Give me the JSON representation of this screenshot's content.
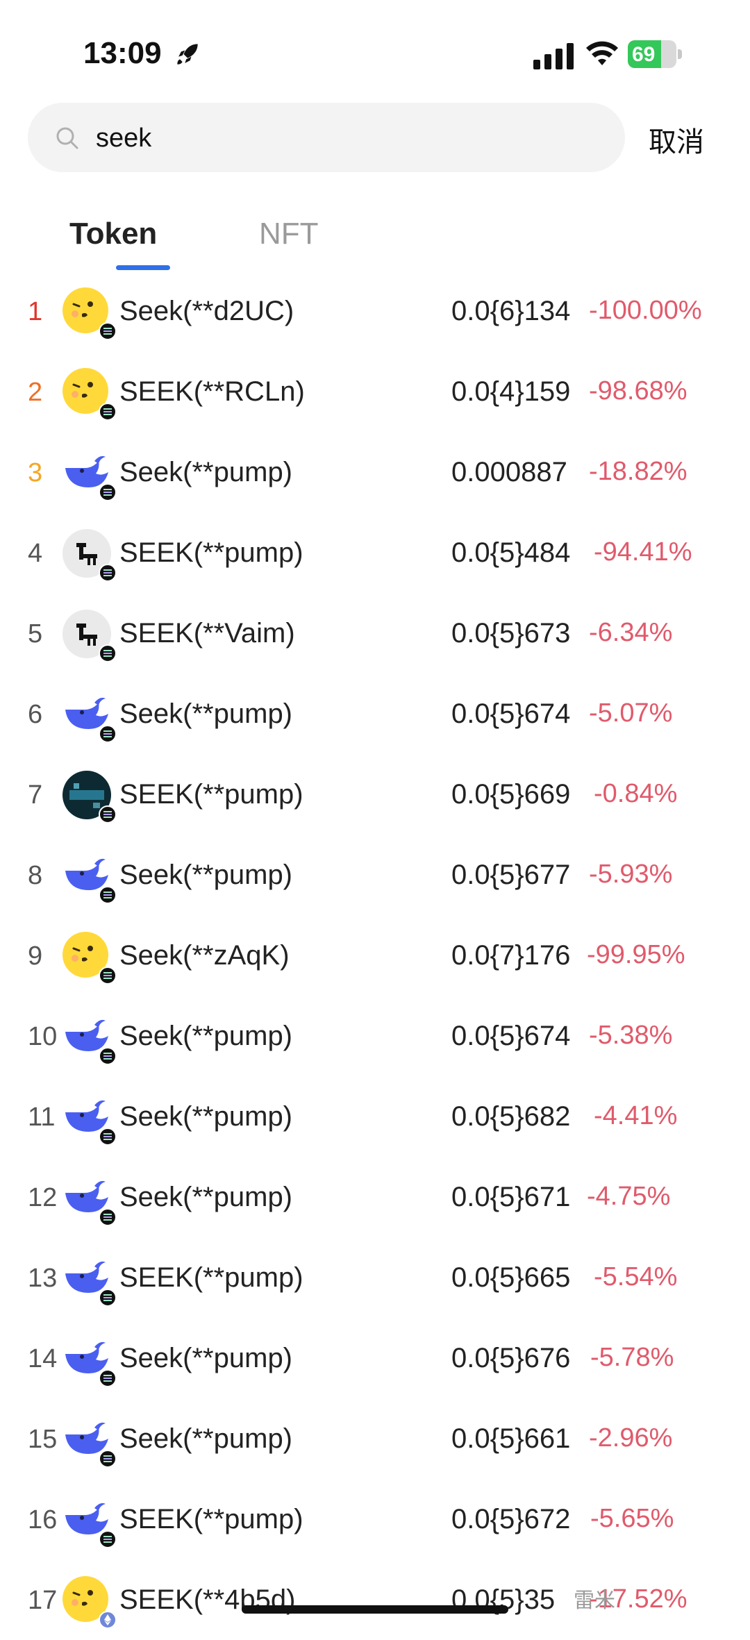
{
  "status_bar": {
    "time": "13:09",
    "battery": "69",
    "battery_level": 0.69
  },
  "search": {
    "value": "seek",
    "cancel_label": "取消"
  },
  "tabs": [
    {
      "label": "Token",
      "active": true
    },
    {
      "label": "NFT",
      "active": false
    }
  ],
  "tokens": [
    {
      "rank": "1",
      "name": "Seek(**d2UC)",
      "price": "0.0{6}134",
      "change": "-100.00%",
      "icon": "emoji-face-icon"
    },
    {
      "rank": "2",
      "name": "SEEK(**RCLn)",
      "price": "0.0{4}159",
      "change": "-98.68%",
      "icon": "emoji-face-icon"
    },
    {
      "rank": "3",
      "name": "Seek(**pump)",
      "price": "0.000887",
      "change": "-18.82%",
      "icon": "blue-whale-icon"
    },
    {
      "rank": "4",
      "name": "SEEK(**pump)",
      "price": "0.0{5}484",
      "change": "-94.41%",
      "icon": "grey-figure-icon"
    },
    {
      "rank": "5",
      "name": "SEEK(**Vaim)",
      "price": "0.0{5}673",
      "change": "-6.34%",
      "icon": "grey-figure-icon"
    },
    {
      "rank": "6",
      "name": "Seek(**pump)",
      "price": "0.0{5}674",
      "change": "-5.07%",
      "icon": "blue-whale-icon"
    },
    {
      "rank": "7",
      "name": "SEEK(**pump)",
      "price": "0.0{5}669",
      "change": "-0.84%",
      "icon": "dark-photo-icon"
    },
    {
      "rank": "8",
      "name": "Seek(**pump)",
      "price": "0.0{5}677",
      "change": "-5.93%",
      "icon": "blue-whale-icon"
    },
    {
      "rank": "9",
      "name": "Seek(**zAqK)",
      "price": "0.0{7}176",
      "change": "-99.95%",
      "icon": "emoji-face-icon"
    },
    {
      "rank": "10",
      "name": "Seek(**pump)",
      "price": "0.0{5}674",
      "change": "-5.38%",
      "icon": "blue-whale-icon"
    },
    {
      "rank": "11",
      "name": "Seek(**pump)",
      "price": "0.0{5}682",
      "change": "-4.41%",
      "icon": "blue-whale-icon"
    },
    {
      "rank": "12",
      "name": "Seek(**pump)",
      "price": "0.0{5}671",
      "change": "-4.75%",
      "icon": "blue-whale-icon"
    },
    {
      "rank": "13",
      "name": "SEEK(**pump)",
      "price": "0.0{5}665",
      "change": "-5.54%",
      "icon": "blue-whale-icon"
    },
    {
      "rank": "14",
      "name": "Seek(**pump)",
      "price": "0.0{5}676",
      "change": "-5.78%",
      "icon": "blue-whale-icon"
    },
    {
      "rank": "15",
      "name": "Seek(**pump)",
      "price": "0.0{5}661",
      "change": "-2.96%",
      "icon": "blue-whale-icon"
    },
    {
      "rank": "16",
      "name": "SEEK(**pump)",
      "price": "0.0{5}672",
      "change": "-5.65%",
      "icon": "blue-whale-icon"
    },
    {
      "rank": "17",
      "name": "SEEK(**4b5d)",
      "price": "0.0{5}35",
      "change": "-17.52%",
      "icon": "emoji-face-icon"
    }
  ],
  "watermark": "雷米",
  "colors": {
    "accent": "#2f6fe8",
    "negative": "#e05a6b",
    "rank1": "#e0352c",
    "rank2": "#ef6f24",
    "rank3": "#f5a623"
  }
}
